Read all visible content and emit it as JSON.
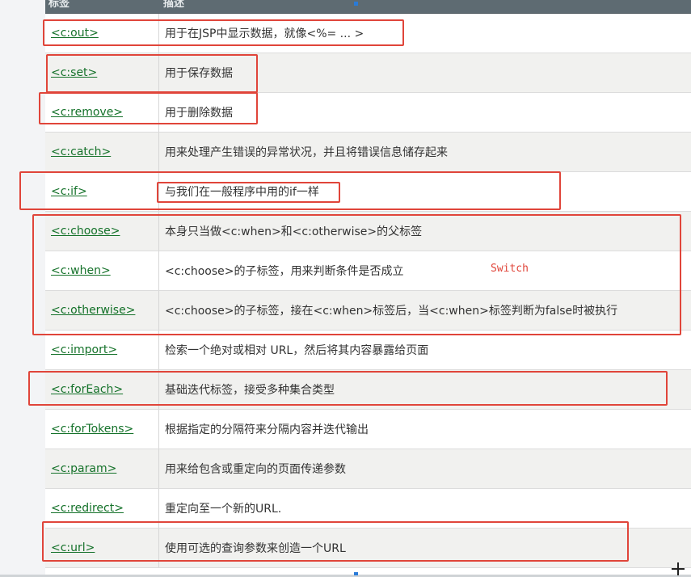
{
  "table": {
    "header": {
      "col1": "标签",
      "col2": "描述"
    },
    "rows": [
      {
        "tag": "<c:out>",
        "desc": "用于在JSP中显示数据，就像<%= ... >"
      },
      {
        "tag": "<c:set>",
        "desc": "用于保存数据"
      },
      {
        "tag": "<c:remove>",
        "desc": "用于删除数据"
      },
      {
        "tag": "<c:catch>",
        "desc": "用来处理产生错误的异常状况，并且将错误信息储存起来"
      },
      {
        "tag": "<c:if>",
        "desc": "与我们在一般程序中用的if一样"
      },
      {
        "tag": "<c:choose>",
        "desc": "本身只当做<c:when>和<c:otherwise>的父标签"
      },
      {
        "tag": "<c:when>",
        "desc": "<c:choose>的子标签，用来判断条件是否成立"
      },
      {
        "tag": "<c:otherwise>",
        "desc": "<c:choose>的子标签，接在<c:when>标签后，当<c:when>标签判断为false时被执行"
      },
      {
        "tag": "<c:import>",
        "desc": "检索一个绝对或相对 URL，然后将其内容暴露给页面"
      },
      {
        "tag": "<c:forEach>",
        "desc": "基础迭代标签，接受多种集合类型"
      },
      {
        "tag": "<c:forTokens>",
        "desc": "根据指定的分隔符来分隔内容并迭代输出"
      },
      {
        "tag": "<c:param>",
        "desc": "用来给包含或重定向的页面传递参数"
      },
      {
        "tag": "<c:redirect>",
        "desc": "重定向至一个新的URL."
      },
      {
        "tag": "<c:url>",
        "desc": "使用可选的查询参数来创造一个URL"
      }
    ]
  },
  "annotation": {
    "note": "Switch"
  },
  "colors": {
    "annotation_red": "#e0453a",
    "tag_link": "#15722a",
    "header_bg": "#5e6b72"
  }
}
